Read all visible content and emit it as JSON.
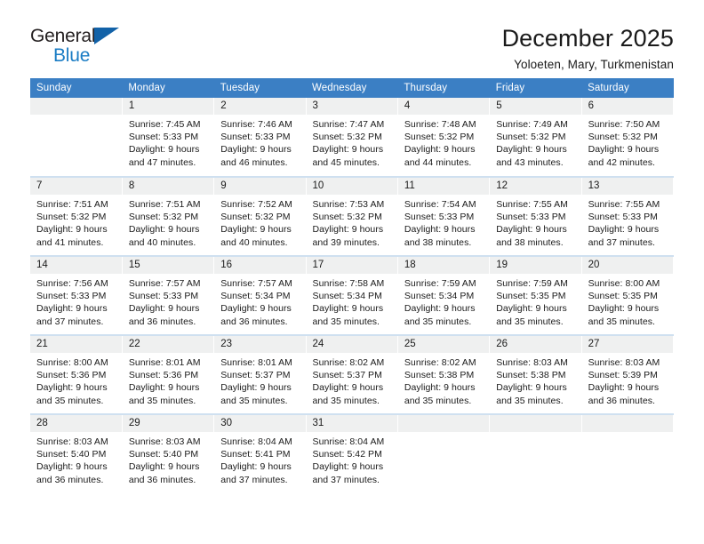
{
  "brand": {
    "name_part1": "General",
    "name_part2": "Blue",
    "triangle_color": "#1262a8",
    "blue_color": "#1a7cc4"
  },
  "header": {
    "title": "December 2025",
    "subtitle": "Yoloeten, Mary, Turkmenistan"
  },
  "theme": {
    "header_row_bg": "#3b7fc4",
    "header_row_text": "#ffffff",
    "daynum_bg": "#eff0f0",
    "row_divider": "#cfe0f0",
    "cell_bg": "#ffffff",
    "text": "#1a1a1a"
  },
  "weekdays": [
    "Sunday",
    "Monday",
    "Tuesday",
    "Wednesday",
    "Thursday",
    "Friday",
    "Saturday"
  ],
  "weeks": [
    [
      {
        "day": "",
        "blank": true,
        "lines": [
          "",
          "",
          "",
          ""
        ]
      },
      {
        "day": "1",
        "lines": [
          "Sunrise: 7:45 AM",
          "Sunset: 5:33 PM",
          "Daylight: 9 hours",
          "and 47 minutes."
        ]
      },
      {
        "day": "2",
        "lines": [
          "Sunrise: 7:46 AM",
          "Sunset: 5:33 PM",
          "Daylight: 9 hours",
          "and 46 minutes."
        ]
      },
      {
        "day": "3",
        "lines": [
          "Sunrise: 7:47 AM",
          "Sunset: 5:32 PM",
          "Daylight: 9 hours",
          "and 45 minutes."
        ]
      },
      {
        "day": "4",
        "lines": [
          "Sunrise: 7:48 AM",
          "Sunset: 5:32 PM",
          "Daylight: 9 hours",
          "and 44 minutes."
        ]
      },
      {
        "day": "5",
        "lines": [
          "Sunrise: 7:49 AM",
          "Sunset: 5:32 PM",
          "Daylight: 9 hours",
          "and 43 minutes."
        ]
      },
      {
        "day": "6",
        "lines": [
          "Sunrise: 7:50 AM",
          "Sunset: 5:32 PM",
          "Daylight: 9 hours",
          "and 42 minutes."
        ]
      }
    ],
    [
      {
        "day": "7",
        "lines": [
          "Sunrise: 7:51 AM",
          "Sunset: 5:32 PM",
          "Daylight: 9 hours",
          "and 41 minutes."
        ]
      },
      {
        "day": "8",
        "lines": [
          "Sunrise: 7:51 AM",
          "Sunset: 5:32 PM",
          "Daylight: 9 hours",
          "and 40 minutes."
        ]
      },
      {
        "day": "9",
        "lines": [
          "Sunrise: 7:52 AM",
          "Sunset: 5:32 PM",
          "Daylight: 9 hours",
          "and 40 minutes."
        ]
      },
      {
        "day": "10",
        "lines": [
          "Sunrise: 7:53 AM",
          "Sunset: 5:32 PM",
          "Daylight: 9 hours",
          "and 39 minutes."
        ]
      },
      {
        "day": "11",
        "lines": [
          "Sunrise: 7:54 AM",
          "Sunset: 5:33 PM",
          "Daylight: 9 hours",
          "and 38 minutes."
        ]
      },
      {
        "day": "12",
        "lines": [
          "Sunrise: 7:55 AM",
          "Sunset: 5:33 PM",
          "Daylight: 9 hours",
          "and 38 minutes."
        ]
      },
      {
        "day": "13",
        "lines": [
          "Sunrise: 7:55 AM",
          "Sunset: 5:33 PM",
          "Daylight: 9 hours",
          "and 37 minutes."
        ]
      }
    ],
    [
      {
        "day": "14",
        "lines": [
          "Sunrise: 7:56 AM",
          "Sunset: 5:33 PM",
          "Daylight: 9 hours",
          "and 37 minutes."
        ]
      },
      {
        "day": "15",
        "lines": [
          "Sunrise: 7:57 AM",
          "Sunset: 5:33 PM",
          "Daylight: 9 hours",
          "and 36 minutes."
        ]
      },
      {
        "day": "16",
        "lines": [
          "Sunrise: 7:57 AM",
          "Sunset: 5:34 PM",
          "Daylight: 9 hours",
          "and 36 minutes."
        ]
      },
      {
        "day": "17",
        "lines": [
          "Sunrise: 7:58 AM",
          "Sunset: 5:34 PM",
          "Daylight: 9 hours",
          "and 35 minutes."
        ]
      },
      {
        "day": "18",
        "lines": [
          "Sunrise: 7:59 AM",
          "Sunset: 5:34 PM",
          "Daylight: 9 hours",
          "and 35 minutes."
        ]
      },
      {
        "day": "19",
        "lines": [
          "Sunrise: 7:59 AM",
          "Sunset: 5:35 PM",
          "Daylight: 9 hours",
          "and 35 minutes."
        ]
      },
      {
        "day": "20",
        "lines": [
          "Sunrise: 8:00 AM",
          "Sunset: 5:35 PM",
          "Daylight: 9 hours",
          "and 35 minutes."
        ]
      }
    ],
    [
      {
        "day": "21",
        "lines": [
          "Sunrise: 8:00 AM",
          "Sunset: 5:36 PM",
          "Daylight: 9 hours",
          "and 35 minutes."
        ]
      },
      {
        "day": "22",
        "lines": [
          "Sunrise: 8:01 AM",
          "Sunset: 5:36 PM",
          "Daylight: 9 hours",
          "and 35 minutes."
        ]
      },
      {
        "day": "23",
        "lines": [
          "Sunrise: 8:01 AM",
          "Sunset: 5:37 PM",
          "Daylight: 9 hours",
          "and 35 minutes."
        ]
      },
      {
        "day": "24",
        "lines": [
          "Sunrise: 8:02 AM",
          "Sunset: 5:37 PM",
          "Daylight: 9 hours",
          "and 35 minutes."
        ]
      },
      {
        "day": "25",
        "lines": [
          "Sunrise: 8:02 AM",
          "Sunset: 5:38 PM",
          "Daylight: 9 hours",
          "and 35 minutes."
        ]
      },
      {
        "day": "26",
        "lines": [
          "Sunrise: 8:03 AM",
          "Sunset: 5:38 PM",
          "Daylight: 9 hours",
          "and 35 minutes."
        ]
      },
      {
        "day": "27",
        "lines": [
          "Sunrise: 8:03 AM",
          "Sunset: 5:39 PM",
          "Daylight: 9 hours",
          "and 36 minutes."
        ]
      }
    ],
    [
      {
        "day": "28",
        "lines": [
          "Sunrise: 8:03 AM",
          "Sunset: 5:40 PM",
          "Daylight: 9 hours",
          "and 36 minutes."
        ]
      },
      {
        "day": "29",
        "lines": [
          "Sunrise: 8:03 AM",
          "Sunset: 5:40 PM",
          "Daylight: 9 hours",
          "and 36 minutes."
        ]
      },
      {
        "day": "30",
        "lines": [
          "Sunrise: 8:04 AM",
          "Sunset: 5:41 PM",
          "Daylight: 9 hours",
          "and 37 minutes."
        ]
      },
      {
        "day": "31",
        "lines": [
          "Sunrise: 8:04 AM",
          "Sunset: 5:42 PM",
          "Daylight: 9 hours",
          "and 37 minutes."
        ]
      },
      {
        "day": "",
        "blank": true,
        "lines": [
          "",
          "",
          "",
          ""
        ]
      },
      {
        "day": "",
        "blank": true,
        "lines": [
          "",
          "",
          "",
          ""
        ]
      },
      {
        "day": "",
        "blank": true,
        "lines": [
          "",
          "",
          "",
          ""
        ]
      }
    ]
  ]
}
